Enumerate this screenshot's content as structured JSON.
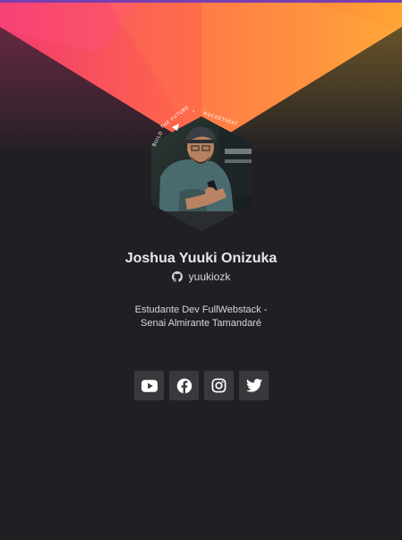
{
  "profile": {
    "name": "Joshua Yuuki Onizuka",
    "github_handle": "yuukiozk",
    "bio_line1": "Estudante Dev FullWebstack -",
    "bio_line2": "Senai Almirante Tamandaré",
    "avatar_ring_text": "BUILD THE FUTURE • ROCKETSEAT •"
  },
  "socials": [
    {
      "name": "youtube",
      "icon": "youtube-icon"
    },
    {
      "name": "facebook",
      "icon": "facebook-icon"
    },
    {
      "name": "instagram",
      "icon": "instagram-icon"
    },
    {
      "name": "twitter",
      "icon": "twitter-icon"
    }
  ],
  "colors": {
    "background": "#211f24",
    "banner_pink": "#f23d6b",
    "banner_orange": "#ffa033",
    "button_bg": "#3a383d",
    "text": "#e8e6ea",
    "top_line": "#7a3fb0"
  }
}
